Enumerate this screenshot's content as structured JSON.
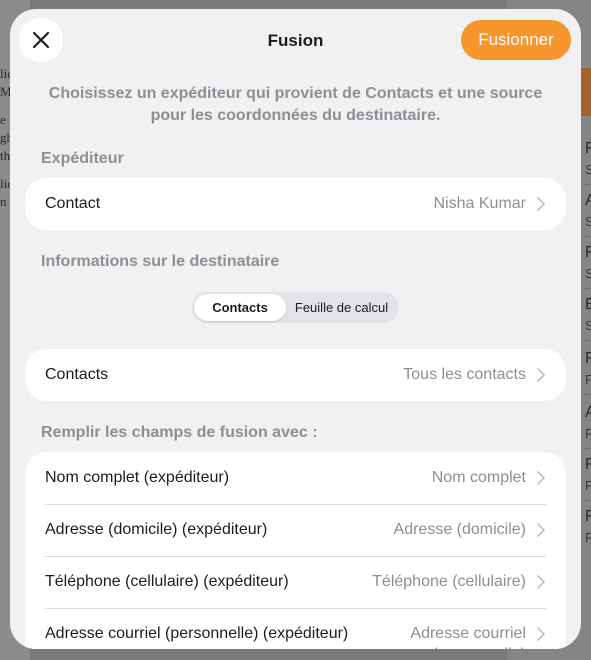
{
  "background": {
    "left_fragments": [
      "lic",
      "M",
      "e f",
      "gh",
      "th",
      "lic",
      "n"
    ],
    "right_letters": [
      {
        "letter": "F",
        "sub": "S"
      },
      {
        "letter": "A",
        "sub": "S"
      },
      {
        "letter": "F",
        "sub": "S"
      },
      {
        "letter": "E",
        "sub": "S"
      },
      {
        "letter": "F",
        "sub": "F"
      },
      {
        "letter": "A",
        "sub": "F"
      },
      {
        "letter": "F",
        "sub": "F"
      },
      {
        "letter": "F",
        "sub": "F"
      }
    ]
  },
  "sheet": {
    "title": "Fusion",
    "primary_button": "Fusionner",
    "intro": "Choisissez un expéditeur qui provient de Contacts et une source pour les coordonnées du destinataire.",
    "sender": {
      "header": "Expéditeur",
      "rows": [
        {
          "label": "Contact",
          "value": "Nisha Kumar"
        }
      ]
    },
    "recipient": {
      "header": "Informations sur le destinataire",
      "segments": [
        "Contacts",
        "Feuille de calcul"
      ],
      "selected_segment": "Contacts",
      "rows": [
        {
          "label": "Contacts",
          "value": "Tous les contacts"
        }
      ]
    },
    "merge_fields": {
      "header": "Remplir les champs de fusion avec :",
      "rows": [
        {
          "label": "Nom complet (expéditeur)",
          "value": "Nom complet"
        },
        {
          "label": "Adresse (domicile) (expéditeur)",
          "value": "Adresse (domicile)"
        },
        {
          "label": "Téléphone (cellulaire) (expéditeur)",
          "value": "Téléphone (cellulaire)"
        },
        {
          "label": "Adresse courriel (personnelle) (expéditeur)",
          "value": "Adresse courriel (personnelle)"
        }
      ]
    }
  },
  "colors": {
    "accent": "#f7962c",
    "sheet_bg": "#f1f1f3",
    "secondary_text": "#8e8e93"
  },
  "icons": {
    "close": "close-icon",
    "disclosure": "chevron-right-icon"
  }
}
